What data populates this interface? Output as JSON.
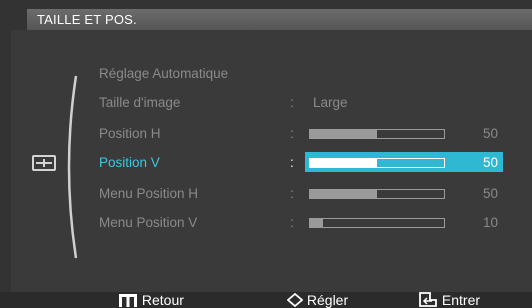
{
  "title": "TAILLE ET POS.",
  "menu": {
    "items": [
      {
        "label": "Réglage Automatique"
      },
      {
        "label": "Taille d'image",
        "colon": ":",
        "value": "Large"
      },
      {
        "label": "Position H",
        "colon": ":",
        "level": 50,
        "max": 100,
        "number": "50"
      },
      {
        "label": "Position V",
        "colon": ":",
        "level": 50,
        "max": 100,
        "number": "50",
        "selected": true
      },
      {
        "label": "Menu Position H",
        "colon": ":",
        "level": 50,
        "max": 100,
        "number": "50"
      },
      {
        "label": "Menu Position V",
        "colon": ":",
        "level": 10,
        "max": 100,
        "number": "10"
      }
    ]
  },
  "footer": {
    "back_label": "Retour",
    "adjust_label": "Régler",
    "enter_label": "Entrer"
  },
  "icons": {
    "category": "size-position-icon",
    "back": "menu-return-icon",
    "adjust": "up-down-arrows-icon",
    "enter": "enter-icon"
  },
  "colors": {
    "background": "#333333",
    "selection": "#2fb8d2",
    "selected_text": "#3cc8e0",
    "inactive_text": "#8a8a8a"
  }
}
